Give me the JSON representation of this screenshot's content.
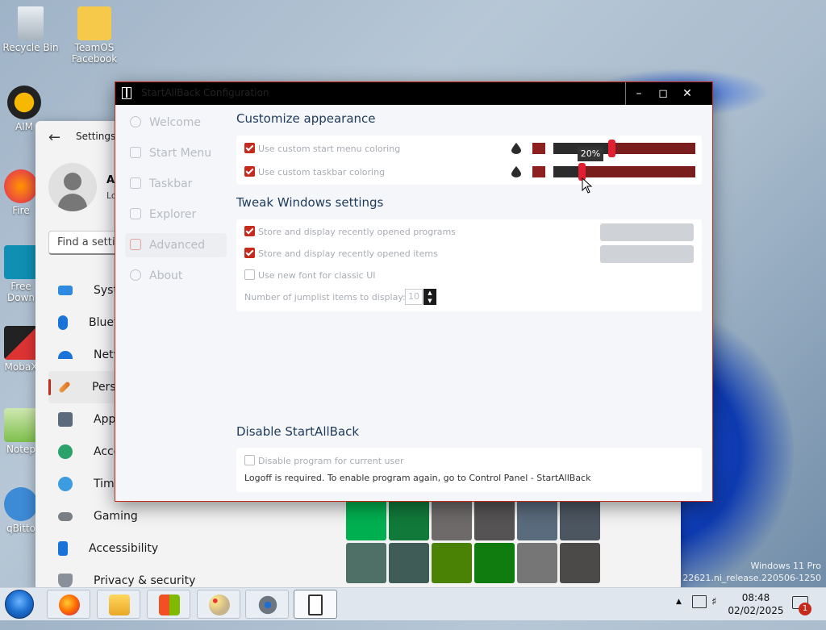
{
  "desktop": {
    "icons": [
      {
        "label": "Recycle Bin"
      },
      {
        "label": "TeamOS Facebook"
      },
      {
        "label": "AIM"
      },
      {
        "label": "Fire"
      },
      {
        "label": "Free Down"
      },
      {
        "label": "MobaX"
      },
      {
        "label": "Notep"
      },
      {
        "label": "qBitto"
      }
    ],
    "watermark_line1": "Windows 11 Pro",
    "watermark_line2": "uild 22621.ni_release.220506-1250"
  },
  "settings": {
    "title": "Settings",
    "user_name": "A",
    "user_sub": "Lo",
    "search_placeholder": "Find a setti",
    "nav": [
      {
        "label": "Syster"
      },
      {
        "label": "Blueto"
      },
      {
        "label": "Netwo"
      },
      {
        "label": "Persor"
      },
      {
        "label": "Apps"
      },
      {
        "label": "Accou"
      },
      {
        "label": "Time a"
      },
      {
        "label": "Gaming"
      },
      {
        "label": "Accessibility"
      },
      {
        "label": "Privacy & security"
      }
    ],
    "swatch_colors": [
      "#00b050",
      "#117a3a",
      "#6e6a6a",
      "#555353",
      "#5a6b7d",
      "#4c5660",
      "#4e7067",
      "#3f5d56",
      "#498205",
      "#107c10",
      "#767676",
      "#4c4a48"
    ]
  },
  "sab": {
    "window_title": "StartAllBack Configuration",
    "sidebar": [
      {
        "label": "Welcome"
      },
      {
        "label": "Start Menu"
      },
      {
        "label": "Taskbar"
      },
      {
        "label": "Explorer"
      },
      {
        "label": "Advanced"
      },
      {
        "label": "About"
      }
    ],
    "appearance": {
      "title": "Customize appearance",
      "start_menu_label": "Use custom start menu coloring",
      "taskbar_label": "Use custom taskbar coloring",
      "swatch_color": "#8e2020",
      "start_menu_slider_fraction": 0.41,
      "taskbar_slider_fraction": 0.2,
      "tooltip": "20%"
    },
    "tweak": {
      "title": "Tweak Windows settings",
      "recent_programs": "Store and display recently opened programs",
      "recent_items": "Store and display recently opened items",
      "new_font": "Use new font for classic UI",
      "jumplist_label": "Number of jumplist items to display:",
      "jumplist_value": "10"
    },
    "disable": {
      "title": "Disable StartAllBack",
      "checkbox_label": "Disable program for current user",
      "note": "Logoff is required. To enable program again, go to Control Panel - StartAllBack"
    }
  },
  "taskbar": {
    "time": "08:48",
    "date": "02/02/2025",
    "notification_count": "1",
    "accent": "#c42b1c"
  }
}
